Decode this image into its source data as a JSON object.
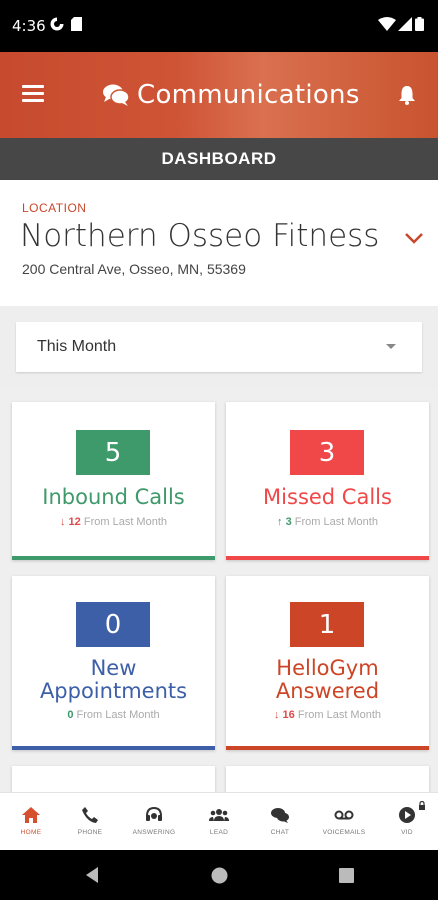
{
  "status_bar": {
    "time": "4:36"
  },
  "app_bar": {
    "title": "Communications"
  },
  "sub_header": {
    "label": "DASHBOARD"
  },
  "location": {
    "label": "LOCATION",
    "name": "Northern Osseo Fitness",
    "address": "200 Central Ave, Osseo, MN, 55369"
  },
  "period_select": {
    "value": "This Month"
  },
  "cards": [
    {
      "value": "5",
      "title_lines": [
        "Inbound Calls"
      ],
      "delta_arrow": "↓",
      "delta_value": "12",
      "delta_text": "From Last Month",
      "color": "#3f9a6b",
      "delta_color": "#e04a4a"
    },
    {
      "value": "3",
      "title_lines": [
        "Missed Calls"
      ],
      "delta_arrow": "↑",
      "delta_value": "3",
      "delta_text": "From Last Month",
      "color": "#f04848",
      "delta_color": "#3f9a6b"
    },
    {
      "value": "0",
      "title_lines": [
        "New",
        "Appointments"
      ],
      "delta_arrow": "",
      "delta_value": "0",
      "delta_text": "From Last Month",
      "color": "#3d5fa8",
      "delta_color": "#3f9a6b"
    },
    {
      "value": "1",
      "title_lines": [
        "HelloGym",
        "Answered"
      ],
      "delta_arrow": "↓",
      "delta_value": "16",
      "delta_text": "From Last Month",
      "color": "#cc4526",
      "delta_color": "#e04a4a"
    }
  ],
  "bottom_nav": [
    {
      "label": "HOME",
      "icon": "home-icon",
      "active": true
    },
    {
      "label": "PHONE",
      "icon": "phone-icon"
    },
    {
      "label": "ANSWERING",
      "icon": "headset-icon"
    },
    {
      "label": "LEAD",
      "icon": "users-icon"
    },
    {
      "label": "CHAT",
      "icon": "chat-icon"
    },
    {
      "label": "VOICEMAILS",
      "icon": "voicemail-icon"
    },
    {
      "label": "VID",
      "icon": "video-play-icon"
    }
  ],
  "colors": {
    "accent": "#c9472b",
    "header_bg": "#474747",
    "active_nav": "#d4502f"
  }
}
